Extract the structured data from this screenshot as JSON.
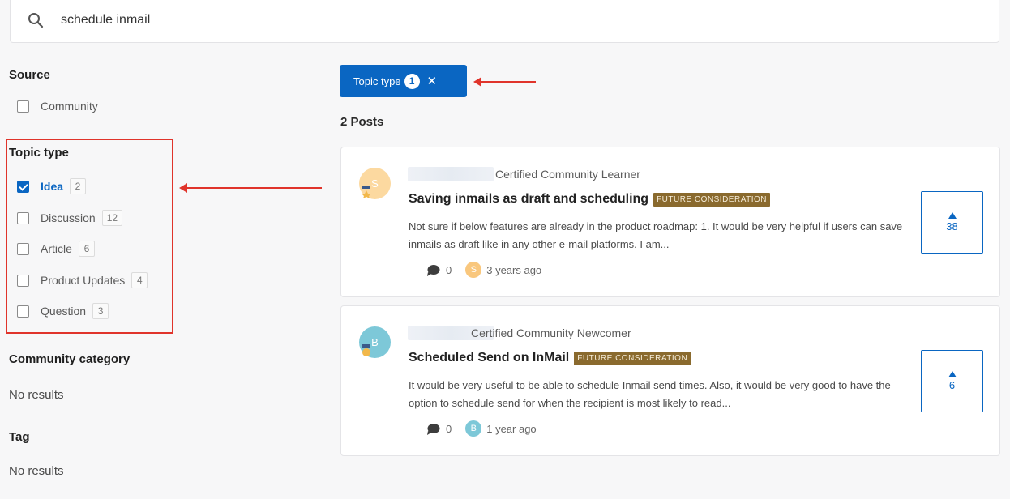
{
  "search": {
    "value": "schedule inmail"
  },
  "sidebar": {
    "source": {
      "title": "Source",
      "options": [
        {
          "label": "Community",
          "checked": false
        }
      ]
    },
    "topic_type": {
      "title": "Topic type",
      "options": [
        {
          "label": "Idea",
          "count": "2",
          "checked": true
        },
        {
          "label": "Discussion",
          "count": "12",
          "checked": false
        },
        {
          "label": "Article",
          "count": "6",
          "checked": false
        },
        {
          "label": "Product Updates",
          "count": "4",
          "checked": false
        },
        {
          "label": "Question",
          "count": "3",
          "checked": false
        }
      ]
    },
    "community_category": {
      "title": "Community category",
      "empty": "No results"
    },
    "tag": {
      "title": "Tag",
      "empty": "No results"
    }
  },
  "active_filter": {
    "label": "Topic type",
    "count": "1",
    "close": "✕"
  },
  "results": {
    "count_label": "2 Posts"
  },
  "posts": [
    {
      "author_role": "Certified Community Learner",
      "avatar_letter": "S",
      "avatar_color": "#f9c77d",
      "title": "Saving inmails as draft and scheduling",
      "status": "FUTURE CONSIDERATION",
      "excerpt": "Not sure if below features are already in the product roadmap: 1. It would be very helpful if users can save inmails as draft like in any other e-mail platforms. I am...",
      "comments": "0",
      "time": "3 years ago",
      "votes": "38"
    },
    {
      "author_role": "Certified Community Newcomer",
      "avatar_letter": "B",
      "avatar_color": "#7dc8d8",
      "title": "Scheduled Send on InMail",
      "status": "FUTURE CONSIDERATION",
      "excerpt": "It would be very useful to be able to schedule Inmail send times. Also, it would be very good to have the option to schedule send for when the recipient is most likely to read...",
      "comments": "0",
      "time": "1 year ago",
      "votes": "6"
    }
  ],
  "colors": {
    "accent": "#0a66c2",
    "annotation": "#e0342b",
    "status_badge": "#8a6a2e"
  }
}
